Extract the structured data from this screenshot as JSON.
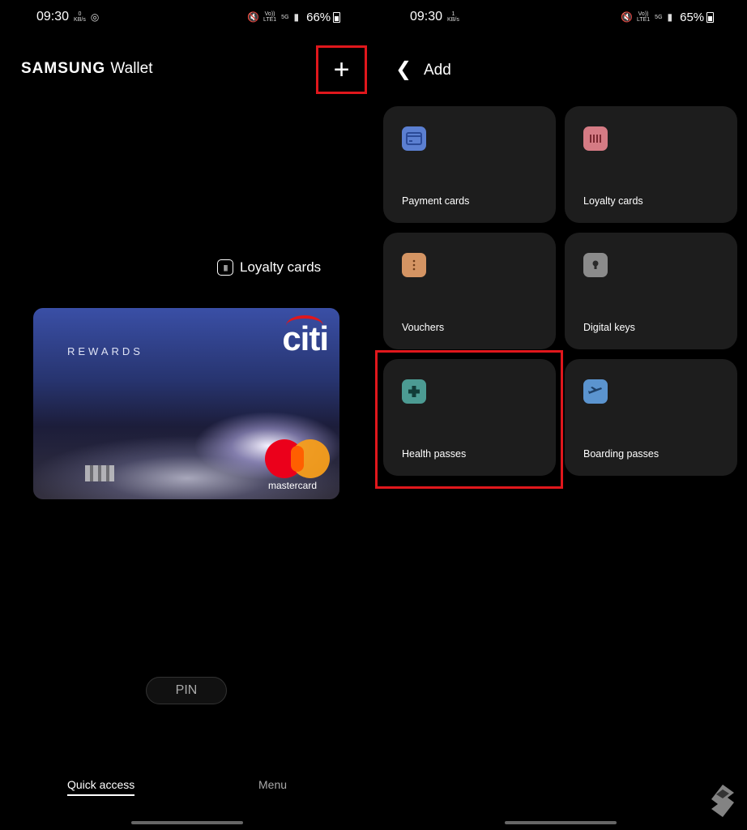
{
  "status_left": {
    "time": "09:30",
    "speed_value": "0",
    "speed_unit": "KB/s",
    "battery": "66%",
    "net1": "Vo))",
    "net2": "LTE1",
    "net3": "5G"
  },
  "status_right": {
    "time": "09:30",
    "speed_value": "1",
    "speed_unit": "KB/s",
    "battery": "65%",
    "net1": "Vo))",
    "net2": "LTE1",
    "net3": "5G"
  },
  "wallet": {
    "brand": "SAMSUNG",
    "brand_suffix": "Wallet",
    "section_title": "Loyalty cards",
    "card": {
      "rewards": "REWARDS",
      "issuer": "citi",
      "network": "mastercard"
    },
    "pin_label": "PIN",
    "tabs": [
      {
        "label": "Quick access"
      },
      {
        "label": "Menu"
      }
    ]
  },
  "add_screen": {
    "title": "Add",
    "tiles": [
      {
        "label": "Payment cards",
        "color": "#5b7fd1"
      },
      {
        "label": "Loyalty cards",
        "color": "#d57b84"
      },
      {
        "label": "Vouchers",
        "color": "#d49463"
      },
      {
        "label": "Digital keys",
        "color": "#8b8b8b"
      },
      {
        "label": "Health passes",
        "color": "#4c9b93"
      },
      {
        "label": "Boarding passes",
        "color": "#5b94cf"
      }
    ]
  },
  "colors": {
    "highlight": "#e0171c",
    "tile_bg": "#1d1d1d"
  }
}
